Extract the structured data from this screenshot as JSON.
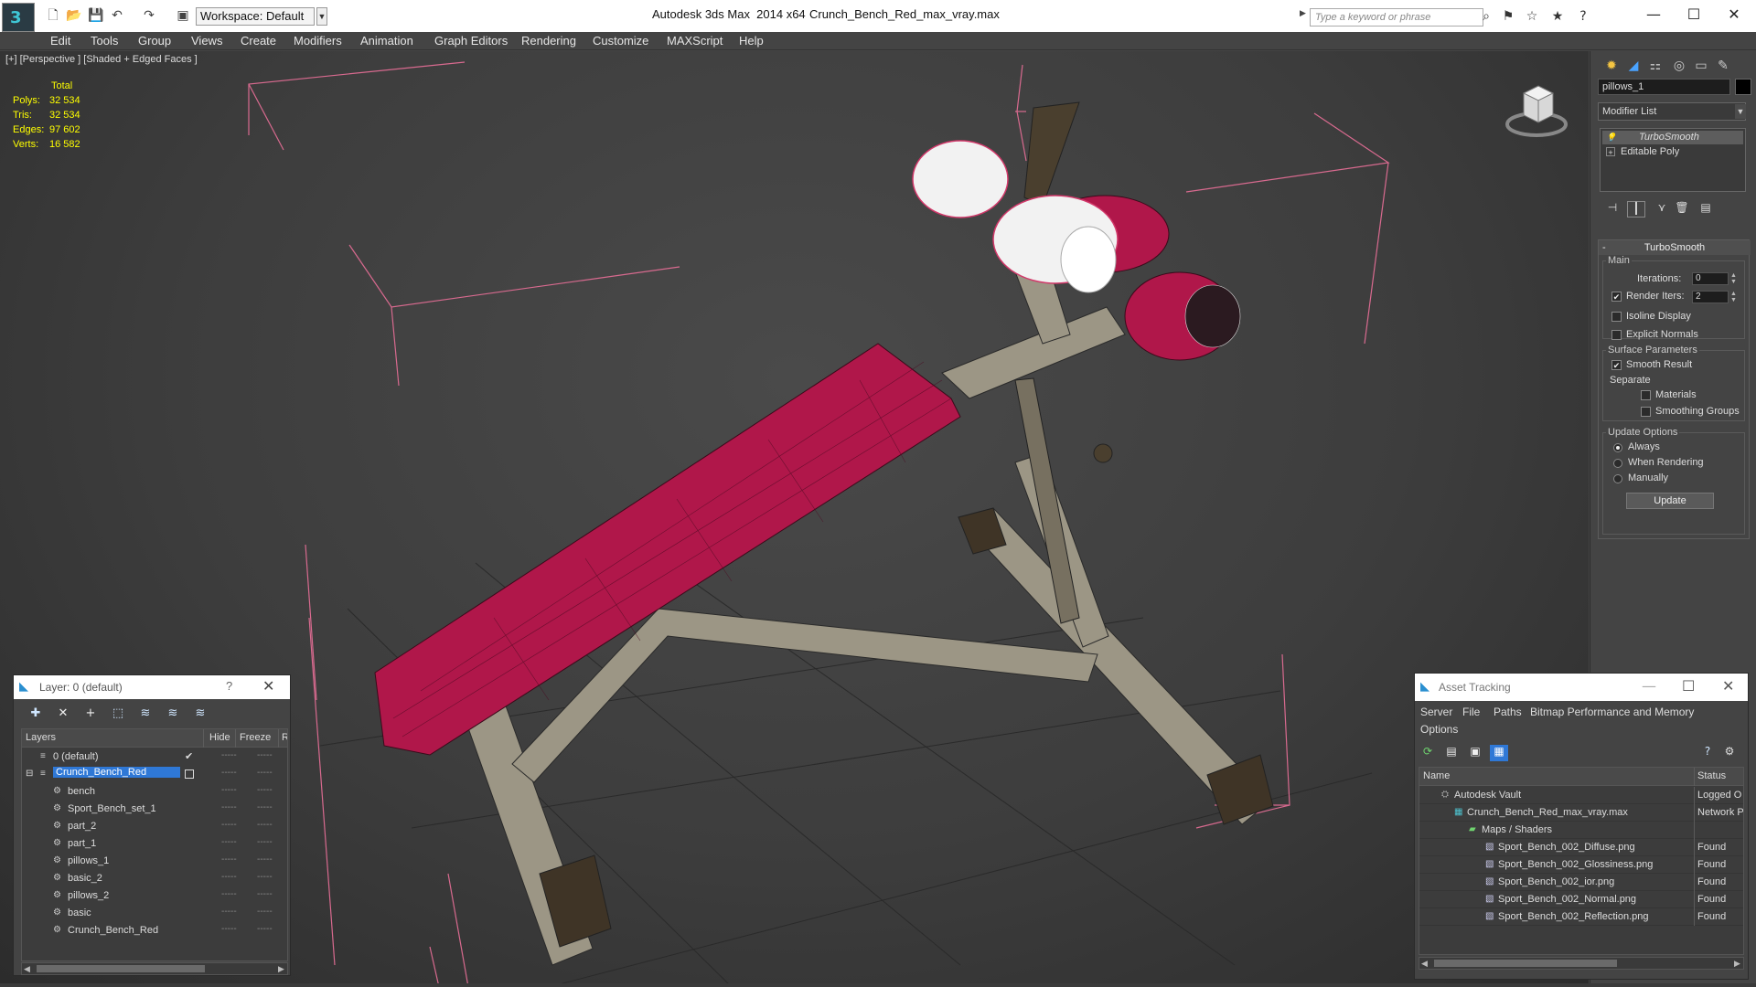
{
  "titlebar": {
    "app_title": "Autodesk 3ds Max  2014 x64",
    "file_title": "Crunch_Bench_Red_max_vray.max",
    "workspace": "Workspace: Default",
    "search_placeholder": "Type a keyword or phrase"
  },
  "menubar": [
    "Edit",
    "Tools",
    "Group",
    "Views",
    "Create",
    "Modifiers",
    "Animation",
    "Graph Editors",
    "Rendering",
    "Customize",
    "MAXScript",
    "Help"
  ],
  "viewport": {
    "label": "[+] [Perspective ] [Shaded + Edged Faces ]",
    "stats": {
      "header": "Total",
      "rows": [
        {
          "label": "Polys:",
          "value": "32 534"
        },
        {
          "label": "Tris:",
          "value": "32 534"
        },
        {
          "label": "Edges:",
          "value": "97 602"
        },
        {
          "label": "Verts:",
          "value": "16 582"
        }
      ]
    },
    "colors": {
      "bounding_box": "#e1819f",
      "cushion": "#b0174a",
      "frame": "#9c9685",
      "feet": "#3f3426"
    }
  },
  "command_panel": {
    "object_name": "pillows_1",
    "modifier_list": "Modifier List",
    "stack": [
      "TurboSmooth",
      "Editable Poly"
    ],
    "rollout_title": "TurboSmooth",
    "main": {
      "group_label": "Main",
      "iterations_label": "Iterations:",
      "iterations_value": "0",
      "render_iters_label": "Render Iters:",
      "render_iters_value": "2",
      "isoline_label": "Isoline Display",
      "explicit_label": "Explicit Normals"
    },
    "surface": {
      "group_label": "Surface Parameters",
      "smooth_label": "Smooth Result",
      "separate_label": "Separate",
      "materials_label": "Materials",
      "smoothing_label": "Smoothing Groups"
    },
    "update": {
      "group_label": "Update Options",
      "always": "Always",
      "when_rendering": "When Rendering",
      "manually": "Manually",
      "button": "Update"
    }
  },
  "layer_window": {
    "title": "Layer: 0 (default)",
    "help": "?",
    "columns": [
      "Layers",
      "Hide",
      "Freeze",
      "R"
    ],
    "rows": [
      {
        "name": "0 (default)",
        "level": 1
      },
      {
        "name": "Crunch_Bench_Red",
        "level": 1
      },
      {
        "name": "bench",
        "level": 2
      },
      {
        "name": "Sport_Bench_set_1",
        "level": 2
      },
      {
        "name": "part_2",
        "level": 2
      },
      {
        "name": "part_1",
        "level": 2
      },
      {
        "name": "pillows_1",
        "level": 2
      },
      {
        "name": "basic_2",
        "level": 2
      },
      {
        "name": "pillows_2",
        "level": 2
      },
      {
        "name": "basic",
        "level": 2
      },
      {
        "name": "Crunch_Bench_Red",
        "level": 2
      }
    ],
    "hide_marker": "-----",
    "freeze_marker": "-----"
  },
  "asset_window": {
    "title": "Asset Tracking",
    "menus": [
      "Server",
      "File",
      "Paths",
      "Bitmap Performance and Memory",
      "Options"
    ],
    "columns": [
      "Name",
      "Status"
    ],
    "rows": [
      {
        "name": "Autodesk Vault",
        "status": "Logged O",
        "level": 1
      },
      {
        "name": "Crunch_Bench_Red_max_vray.max",
        "status": "Network P",
        "level": 2
      },
      {
        "name": "Maps / Shaders",
        "status": "",
        "level": 3
      },
      {
        "name": "Sport_Bench_002_Diffuse.png",
        "status": "Found",
        "level": 4
      },
      {
        "name": "Sport_Bench_002_Glossiness.png",
        "status": "Found",
        "level": 4
      },
      {
        "name": "Sport_Bench_002_ior.png",
        "status": "Found",
        "level": 4
      },
      {
        "name": "Sport_Bench_002_Normal.png",
        "status": "Found",
        "level": 4
      },
      {
        "name": "Sport_Bench_002_Reflection.png",
        "status": "Found",
        "level": 4
      }
    ]
  }
}
